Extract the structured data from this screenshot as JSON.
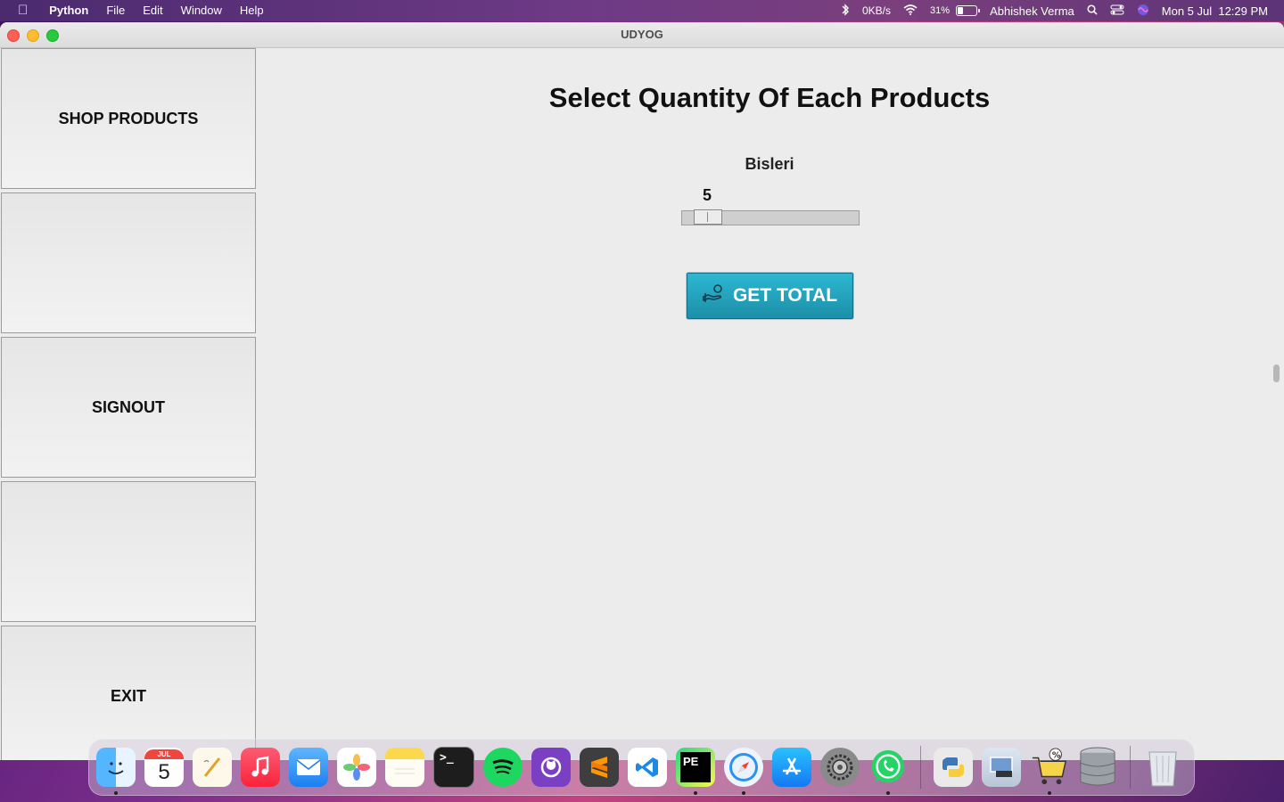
{
  "menubar": {
    "app_name": "Python",
    "menus": [
      "File",
      "Edit",
      "Window",
      "Help"
    ],
    "net_speed": "0KB/s",
    "battery_percent": "31%",
    "battery_level": 0.31,
    "user_name": "Abhishek Verma",
    "datetime": "Mon 5 Jul  12:29 PM"
  },
  "window": {
    "title": "UDYOG"
  },
  "sidebar": {
    "items": [
      {
        "label": "SHOP PRODUCTS"
      },
      {
        "label": ""
      },
      {
        "label": "SIGNOUT"
      },
      {
        "label": ""
      },
      {
        "label": "EXIT"
      }
    ]
  },
  "main": {
    "heading": "Select Quantity Of Each Products",
    "products": [
      {
        "name": "Bisleri",
        "quantity": "5",
        "slider_value": 5
      }
    ],
    "total_button_label": "GET TOTAL"
  },
  "dock": {
    "apps": [
      {
        "name": "Finder",
        "icon": "finder-icon",
        "color": "#3a8ef0",
        "running": true
      },
      {
        "name": "Calendar",
        "icon": "calendar-icon",
        "color": "#ffffff",
        "month": "JUL",
        "day": "5",
        "running": false
      },
      {
        "name": "TextEdit",
        "icon": "textedit-icon",
        "color": "#f8f3e6",
        "running": false
      },
      {
        "name": "Music",
        "icon": "music-icon",
        "color": "#f83a4f",
        "running": false
      },
      {
        "name": "Mail",
        "icon": "mail-icon",
        "color": "#2f8ef3",
        "running": false
      },
      {
        "name": "Photos",
        "icon": "photos-icon",
        "color": "#ffffff",
        "running": false
      },
      {
        "name": "Notes",
        "icon": "notes-icon",
        "color": "#fbe27a",
        "running": false
      },
      {
        "name": "Terminal",
        "icon": "terminal-icon",
        "color": "#1d1d1d",
        "running": false
      },
      {
        "name": "Spotify",
        "icon": "spotify-icon",
        "color": "#1ed760",
        "running": false
      },
      {
        "name": "GitHub Desktop",
        "icon": "github-icon",
        "color": "#7b3fc4",
        "running": false
      },
      {
        "name": "Sublime Text",
        "icon": "sublime-icon",
        "color": "#3e3e3e",
        "running": false
      },
      {
        "name": "VS Code",
        "icon": "vscode-icon",
        "color": "#ffffff",
        "running": false
      },
      {
        "name": "PyCharm",
        "icon": "pycharm-icon",
        "color": "#1c1c1c",
        "running": true
      },
      {
        "name": "Safari",
        "icon": "safari-icon",
        "color": "#e9f3ff",
        "running": true
      },
      {
        "name": "App Store",
        "icon": "appstore-icon",
        "color": "#1a8cf5",
        "running": false
      },
      {
        "name": "System Preferences",
        "icon": "settings-icon",
        "color": "#8a8a8a",
        "running": false
      },
      {
        "name": "WhatsApp",
        "icon": "whatsapp-icon",
        "color": "#25d366",
        "running": true
      }
    ],
    "recent": [
      {
        "name": "Python Launcher",
        "icon": "python-icon",
        "color": "#e8e8e8",
        "running": false
      },
      {
        "name": "Preview",
        "icon": "preview-icon",
        "color": "#cfd7e3",
        "running": false
      },
      {
        "name": "Shop",
        "icon": "shopping-cart-icon",
        "color": "#f6d44a",
        "running": true
      },
      {
        "name": "Database",
        "icon": "database-icon",
        "color": "#9aa0a6",
        "running": false
      }
    ],
    "trash": {
      "name": "Trash",
      "icon": "trash-icon",
      "color": "#d9dde2"
    }
  },
  "colors": {
    "accent": "#2db7d2",
    "window_bg": "#ececec"
  }
}
